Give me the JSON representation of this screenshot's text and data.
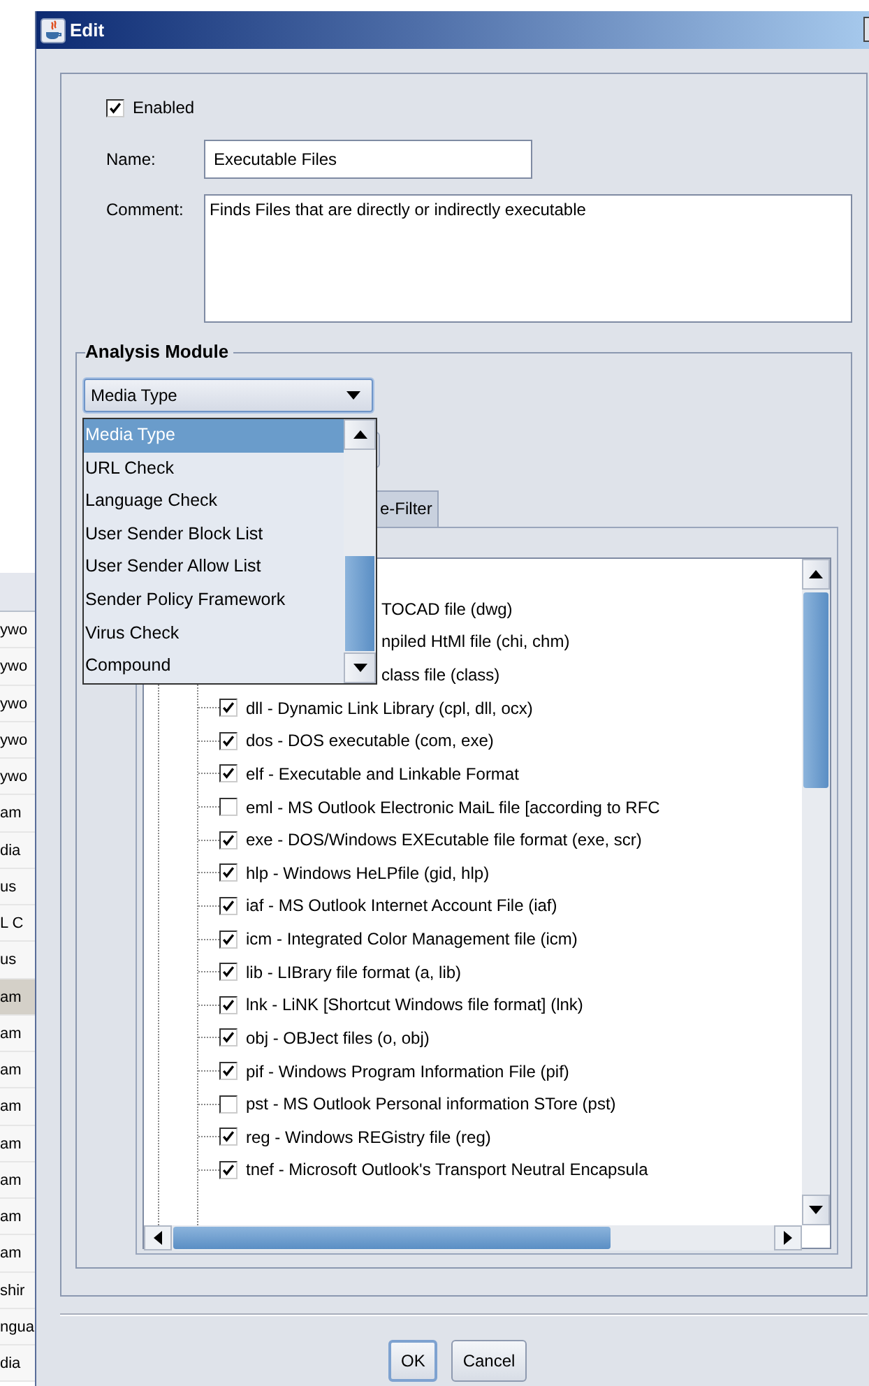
{
  "background_table": {
    "rows": [
      {
        "text": "ywo",
        "selected": false
      },
      {
        "text": "ywo",
        "selected": false
      },
      {
        "text": "ywo",
        "selected": false
      },
      {
        "text": "ywo",
        "selected": false
      },
      {
        "text": "ywo",
        "selected": false
      },
      {
        "text": "am",
        "selected": false
      },
      {
        "text": "dia",
        "selected": false
      },
      {
        "text": "us",
        "selected": false
      },
      {
        "text": "L C",
        "selected": false
      },
      {
        "text": "us",
        "selected": false
      },
      {
        "text": "am",
        "selected": true
      },
      {
        "text": "am",
        "selected": false
      },
      {
        "text": "am",
        "selected": false
      },
      {
        "text": "am",
        "selected": false
      },
      {
        "text": "am",
        "selected": false
      },
      {
        "text": "am",
        "selected": false
      },
      {
        "text": "am",
        "selected": false
      },
      {
        "text": "am",
        "selected": false
      },
      {
        "text": "shir",
        "selected": false
      },
      {
        "text": "ngua",
        "selected": false
      },
      {
        "text": "dia",
        "selected": false
      }
    ]
  },
  "window": {
    "title": "Edit"
  },
  "enabled": {
    "label": "Enabled",
    "checked": true
  },
  "name": {
    "label": "Name:",
    "value": "Executable Files"
  },
  "comment": {
    "label": "Comment:",
    "value": "Finds Files that are directly or indirectly executable"
  },
  "analysis_module": {
    "title": "Analysis Module",
    "dropdown": {
      "value": "Media Type",
      "expanded": true,
      "options": [
        {
          "label": "Media Type",
          "selected": true
        },
        {
          "label": "URL Check",
          "selected": false
        },
        {
          "label": "Language Check",
          "selected": false
        },
        {
          "label": "User Sender Block List",
          "selected": false
        },
        {
          "label": "User Sender Allow List",
          "selected": false
        },
        {
          "label": "Sender Policy Framework",
          "selected": false
        },
        {
          "label": "Virus Check",
          "selected": false
        },
        {
          "label": "Compound",
          "selected": false
        }
      ]
    },
    "tabs": [
      {
        "label": "e-Filter",
        "selected": false
      }
    ],
    "file_types": [
      {
        "kind": "partial",
        "label": "TOCAD file (dwg)"
      },
      {
        "kind": "partial",
        "label": "npiled HtMl file (chi, chm)"
      },
      {
        "kind": "partial",
        "label": "class file (class)"
      },
      {
        "kind": "file",
        "label": "dll - Dynamic Link Library (cpl, dll, ocx)",
        "checked": true
      },
      {
        "kind": "file",
        "label": "dos - DOS executable (com, exe)",
        "checked": true
      },
      {
        "kind": "file",
        "label": "elf - Executable and Linkable Format",
        "checked": true
      },
      {
        "kind": "file",
        "label": "eml - MS Outlook Electronic MaiL file [according to RFC",
        "checked": false
      },
      {
        "kind": "file",
        "label": "exe - DOS/Windows EXEcutable file format (exe, scr)",
        "checked": true
      },
      {
        "kind": "file",
        "label": "hlp - Windows HeLPfile (gid, hlp)",
        "checked": true
      },
      {
        "kind": "file",
        "label": "iaf - MS Outlook Internet Account File (iaf)",
        "checked": true
      },
      {
        "kind": "file",
        "label": "icm - Integrated Color Management file (icm)",
        "checked": true
      },
      {
        "kind": "file",
        "label": "lib - LIBrary file format (a, lib)",
        "checked": true
      },
      {
        "kind": "file",
        "label": "lnk - LiNK [Shortcut Windows file format] (lnk)",
        "checked": true
      },
      {
        "kind": "file",
        "label": "obj - OBJect files (o, obj)",
        "checked": true
      },
      {
        "kind": "file",
        "label": "pif - Windows Program Information File (pif)",
        "checked": true
      },
      {
        "kind": "file",
        "label": "pst - MS Outlook Personal information STore (pst)",
        "checked": false
      },
      {
        "kind": "file",
        "label": "reg - Windows REGistry file (reg)",
        "checked": true
      },
      {
        "kind": "file",
        "label": "tnef - Microsoft Outlook's Transport Neutral Encapsula",
        "checked": true
      }
    ]
  },
  "buttons": [
    {
      "label": "OK",
      "default": true
    },
    {
      "label": "Cancel",
      "default": false
    }
  ]
}
